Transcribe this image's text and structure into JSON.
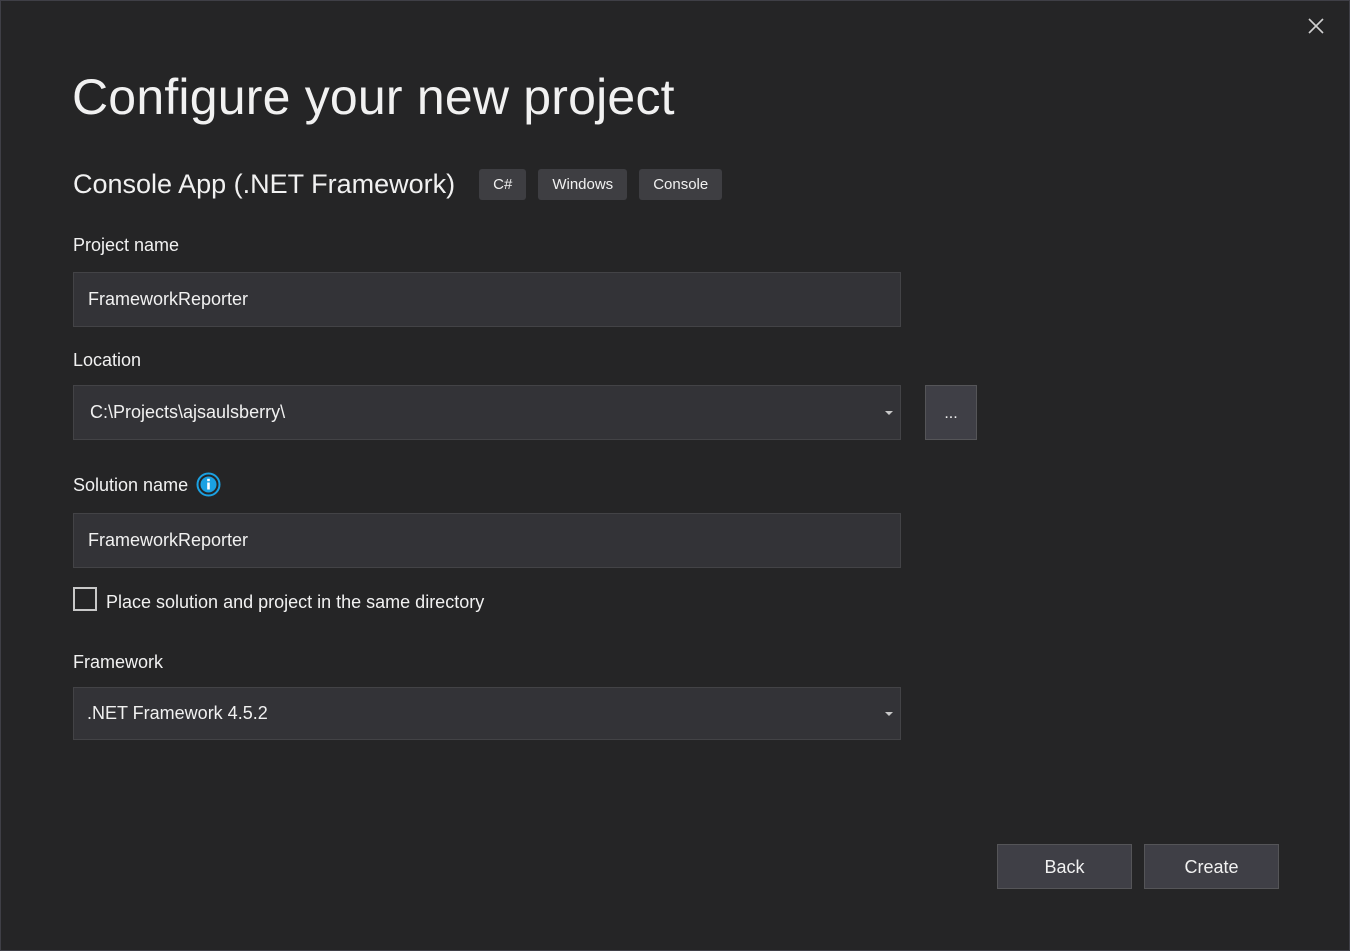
{
  "dialog": {
    "title": "Configure your new project",
    "close_icon": "close-icon"
  },
  "template": {
    "name": "Console App (.NET Framework)",
    "tags": [
      "C#",
      "Windows",
      "Console"
    ]
  },
  "project_name": {
    "label": "Project name",
    "value": "FrameworkReporter"
  },
  "location": {
    "label": "Location",
    "value": "C:\\Projects\\ajsaulsberry\\",
    "browse_label": "..."
  },
  "solution_name": {
    "label": "Solution name",
    "value": "FrameworkReporter",
    "info_icon": "info-icon",
    "info_color": "#1ba1e2"
  },
  "same_directory": {
    "label": "Place solution and project in the same directory",
    "checked": false
  },
  "framework": {
    "label": "Framework",
    "value": ".NET Framework 4.5.2"
  },
  "footer": {
    "back_label": "Back",
    "create_label": "Create"
  }
}
